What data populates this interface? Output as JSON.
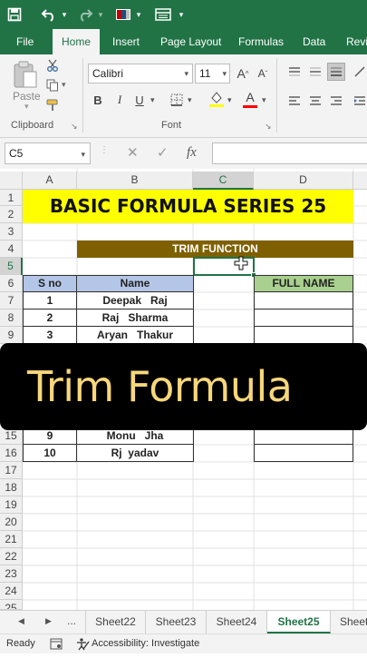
{
  "qat": {
    "save_icon": "save-icon",
    "undo_icon": "undo-icon",
    "redo_icon": "redo-icon",
    "layout_icon": "table-layout-icon"
  },
  "tabs": [
    {
      "label": "File",
      "active": false
    },
    {
      "label": "Home",
      "active": true
    },
    {
      "label": "Insert",
      "active": false
    },
    {
      "label": "Page Layout",
      "active": false
    },
    {
      "label": "Formulas",
      "active": false
    },
    {
      "label": "Data",
      "active": false
    },
    {
      "label": "Revi",
      "active": false
    }
  ],
  "ribbon": {
    "paste_label": "Paste",
    "clipboard_label": "Clipboard",
    "font_group_label": "Font",
    "font_name": "Calibri",
    "font_size": "11",
    "bold": "B",
    "italic": "I",
    "underline": "U",
    "grow_font": "A",
    "shrink_font": "A",
    "font_color_letter": "A"
  },
  "formula_bar": {
    "name_box": "C5",
    "cancel": "✕",
    "enter": "✓",
    "fx": "fx",
    "value": ""
  },
  "columns": [
    "A",
    "B",
    "C",
    "D"
  ],
  "selected_column": "C",
  "rows": [
    "1",
    "2",
    "3",
    "4",
    "5",
    "6",
    "7",
    "8",
    "9",
    "15",
    "16",
    "17",
    "18",
    "19",
    "20",
    "21",
    "22",
    "23",
    "24",
    "25"
  ],
  "cells": {
    "title": "BASIC FORMULA SERIES 25",
    "trim_header": "TRIM FUNCTION",
    "sno_header": "S no",
    "name_header": "Name",
    "fullname_header": "FULL NAME",
    "data_rows": [
      {
        "sno": "1",
        "name": "Deepak   Raj"
      },
      {
        "sno": "2",
        "name": "Raj   Sharma"
      },
      {
        "sno": "3",
        "name": "Aryan   Thakur"
      },
      {
        "sno": "9",
        "name": "Monu   Jha"
      },
      {
        "sno": "10",
        "name": "Rj  yadav"
      }
    ]
  },
  "overlay_text": "Trim Formula",
  "sheets": [
    {
      "label": "Sheet22",
      "active": false
    },
    {
      "label": "Sheet23",
      "active": false
    },
    {
      "label": "Sheet24",
      "active": false
    },
    {
      "label": "Sheet25",
      "active": true
    },
    {
      "label": "Sheet",
      "active": false
    }
  ],
  "sheet_nav": {
    "prev": "◀",
    "next": "▶",
    "more": "..."
  },
  "status": {
    "ready": "Ready",
    "accessibility": "Accessibility: Investigate"
  },
  "colors": {
    "excel_green": "#217346",
    "title_fill": "#ffff00",
    "trim_fill": "#7f6000",
    "header_fill": "#b4c6e7",
    "fullname_fill": "#a9d08e",
    "overlay_text": "#f7d77a"
  }
}
